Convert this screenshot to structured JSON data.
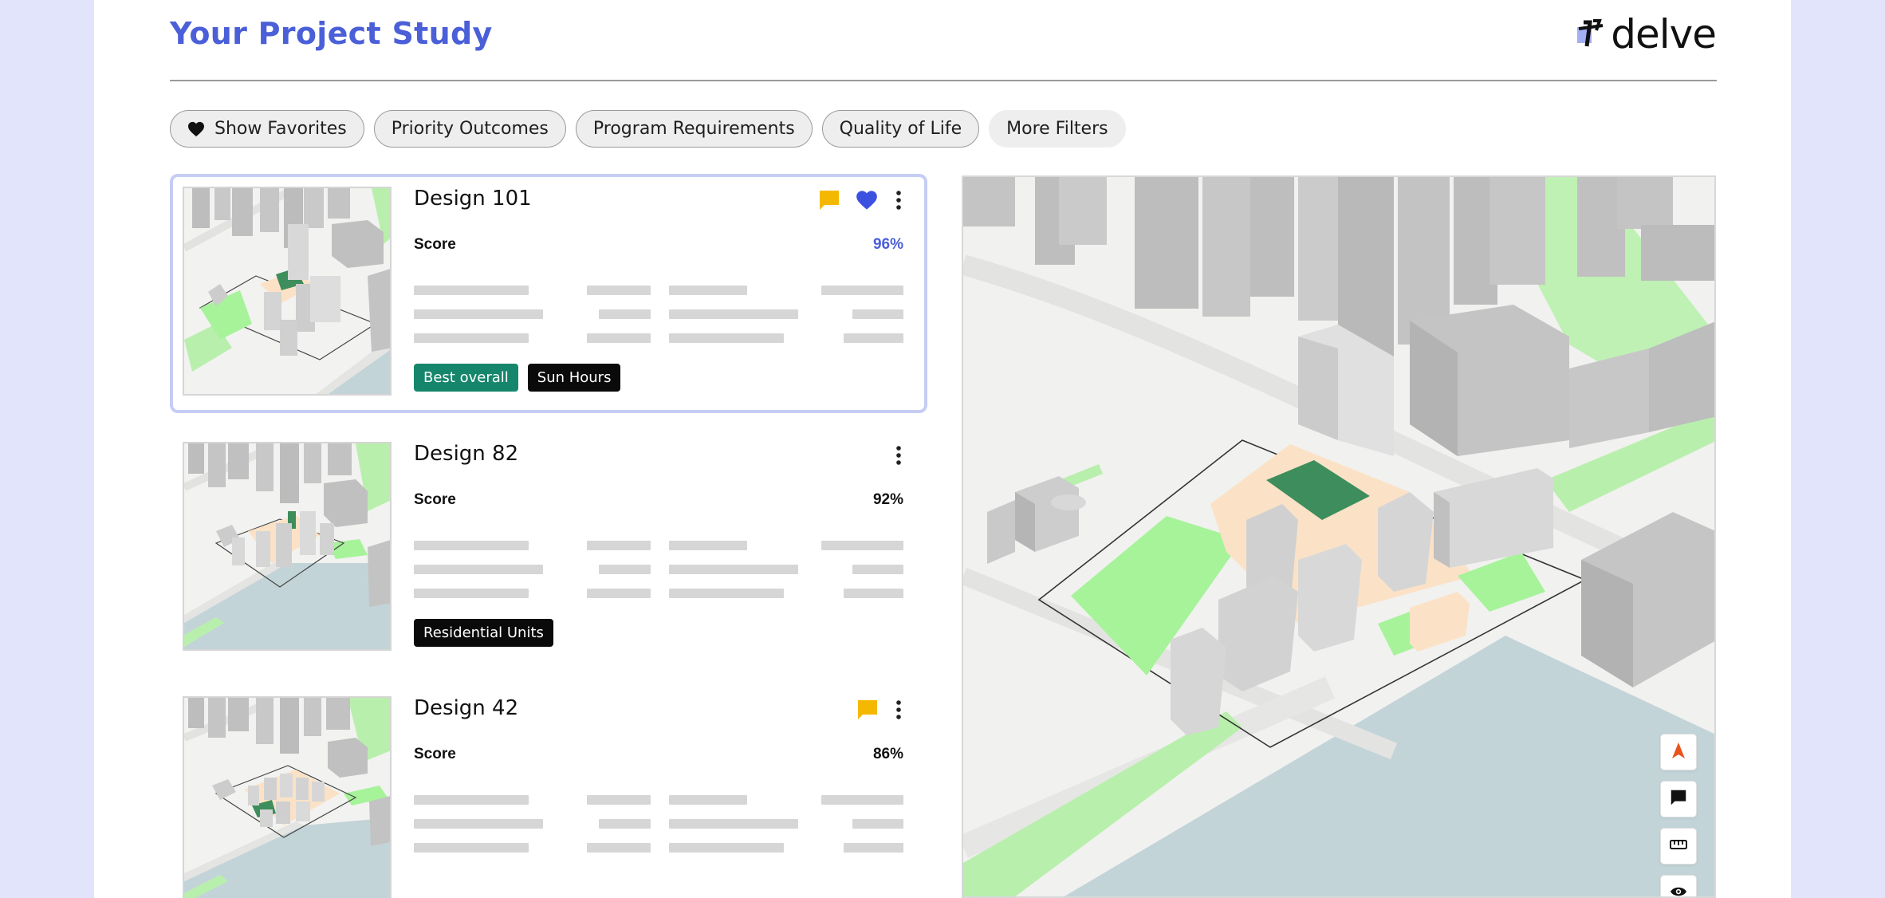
{
  "header": {
    "title": "Your Project Study",
    "logo_text": "delve"
  },
  "filters": [
    {
      "label": "Show Favorites",
      "icon": "heart-icon"
    },
    {
      "label": "Priority Outcomes"
    },
    {
      "label": "Program Requirements"
    },
    {
      "label": "Quality of Life"
    },
    {
      "label": "More Filters"
    }
  ],
  "designs": [
    {
      "name": "Design 101",
      "score_label": "Score",
      "score": "96%",
      "score_numeric": 0.96,
      "selected": true,
      "comment": true,
      "favorite": true,
      "tags": [
        "Best overall",
        "Sun Hours"
      ]
    },
    {
      "name": "Design 82",
      "score_label": "Score",
      "score": "92%",
      "score_numeric": 0.92,
      "selected": false,
      "comment": false,
      "favorite": false,
      "tags": [
        "Residential Units"
      ]
    },
    {
      "name": "Design 42",
      "score_label": "Score",
      "score": "86%",
      "score_numeric": 0.86,
      "selected": false,
      "comment": true,
      "favorite": false,
      "tags": []
    }
  ],
  "map_tools": [
    "compass-icon",
    "comment-icon",
    "ruler-icon",
    "eye-icon"
  ],
  "colors": {
    "accent": "#4a5fd8",
    "comment": "#f5b800",
    "tag_green": "#15866b",
    "tag_black": "#0a0a0a",
    "page_bg": "#e1e4fb",
    "compass": "#e8541c"
  }
}
